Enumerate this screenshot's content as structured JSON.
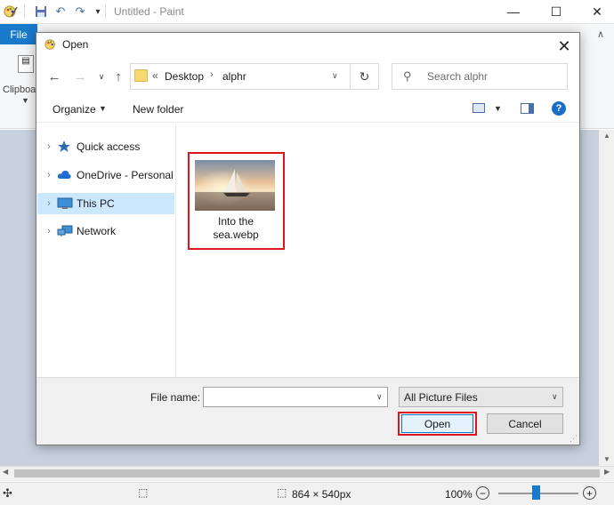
{
  "paint": {
    "title": "Untitled - Paint",
    "file_tab": "File",
    "clipboard_label": "Clipboa",
    "status": {
      "dimensions": "864 × 540px",
      "zoom": "100%"
    }
  },
  "dialog": {
    "title": "Open",
    "breadcrumb": {
      "root_chevron": "«",
      "items": [
        "Desktop",
        "alphr"
      ]
    },
    "search_placeholder": "Search alphr",
    "toolbar": {
      "organize_label": "Organize",
      "new_folder_label": "New folder"
    },
    "nav_items": [
      {
        "label": "Quick access",
        "icon": "star-icon"
      },
      {
        "label": "OneDrive - Personal",
        "icon": "cloud-icon"
      },
      {
        "label": "This PC",
        "icon": "computer-icon",
        "selected": true
      },
      {
        "label": "Network",
        "icon": "network-icon"
      }
    ],
    "file": {
      "name_line1": "Into the",
      "name_line2": "sea.webp"
    },
    "filename_label": "File name:",
    "filename_value": "",
    "filetype_selected": "All Picture Files",
    "open_label": "Open",
    "cancel_label": "Cancel"
  },
  "colors": {
    "accent": "#0078d7",
    "highlight_outline": "#e0141e",
    "file_tab": "#1979ca",
    "selected_nav": "#cce8ff"
  }
}
